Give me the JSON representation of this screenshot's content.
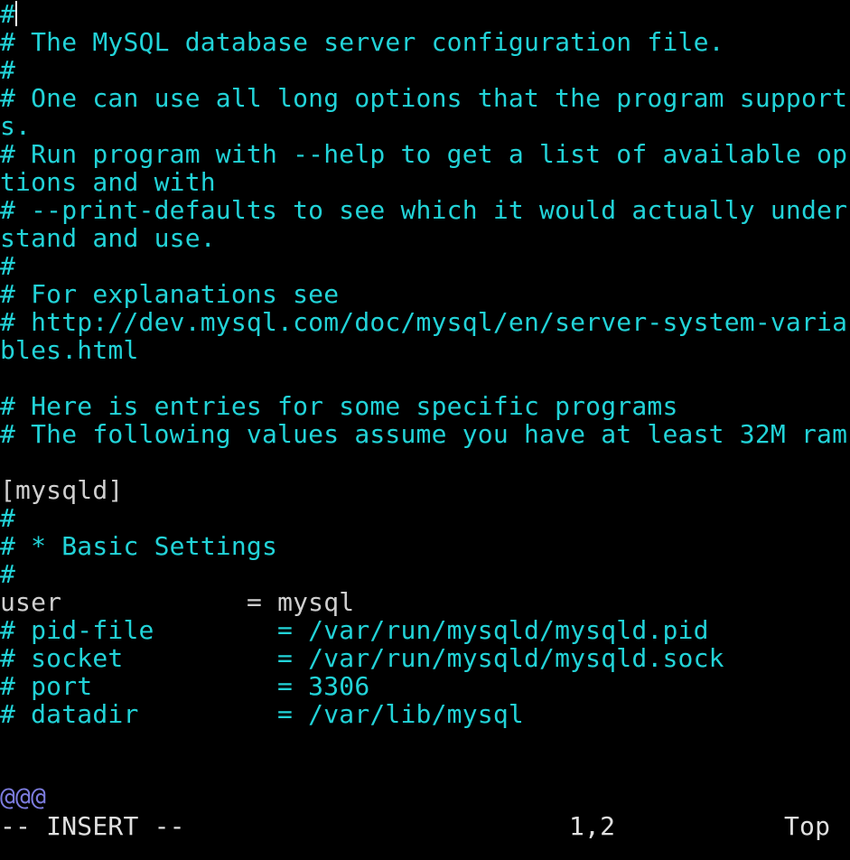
{
  "editor": {
    "lines": [
      {
        "text": "#",
        "cls": "c-comment",
        "cursor": true
      },
      {
        "text": "# The MySQL database server configuration file.",
        "cls": "c-comment"
      },
      {
        "text": "#",
        "cls": "c-comment"
      },
      {
        "text": "# One can use all long options that the program support",
        "cls": "c-comment"
      },
      {
        "text": "s.",
        "cls": "c-comment"
      },
      {
        "text": "# Run program with --help to get a list of available op",
        "cls": "c-comment"
      },
      {
        "text": "tions and with",
        "cls": "c-comment"
      },
      {
        "text": "# --print-defaults to see which it would actually under",
        "cls": "c-comment"
      },
      {
        "text": "stand and use.",
        "cls": "c-comment"
      },
      {
        "text": "#",
        "cls": "c-comment"
      },
      {
        "text": "# For explanations see",
        "cls": "c-comment"
      },
      {
        "text": "# http://dev.mysql.com/doc/mysql/en/server-system-varia",
        "cls": "c-comment"
      },
      {
        "text": "bles.html",
        "cls": "c-comment"
      },
      {
        "text": "",
        "cls": "c-plain"
      },
      {
        "text": "# Here is entries for some specific programs",
        "cls": "c-comment"
      },
      {
        "text": "# The following values assume you have at least 32M ram",
        "cls": "c-comment"
      },
      {
        "text": "",
        "cls": "c-plain"
      },
      {
        "text": "[mysqld]",
        "cls": "c-section"
      },
      {
        "text": "#",
        "cls": "c-comment"
      },
      {
        "text": "# * Basic Settings",
        "cls": "c-comment"
      },
      {
        "text": "#",
        "cls": "c-comment"
      },
      {
        "key": "user",
        "eq": "= ",
        "value": "mysql",
        "kind": "setting"
      },
      {
        "text": "# pid-file        = /var/run/mysqld/mysqld.pid",
        "cls": "c-comment"
      },
      {
        "text": "# socket          = /var/run/mysqld/mysqld.sock",
        "cls": "c-comment"
      },
      {
        "text": "# port            = 3306",
        "cls": "c-comment"
      },
      {
        "text": "# datadir         = /var/lib/mysql",
        "cls": "c-comment"
      }
    ],
    "overflow_marker": "@@@"
  },
  "statusline": {
    "mode": "-- INSERT --",
    "ruler": "1,2",
    "position": "Top"
  },
  "colors": {
    "background": "#000000",
    "comment": "#22d3d8",
    "text": "#cfcfcf",
    "marker": "#7b7bdc"
  }
}
